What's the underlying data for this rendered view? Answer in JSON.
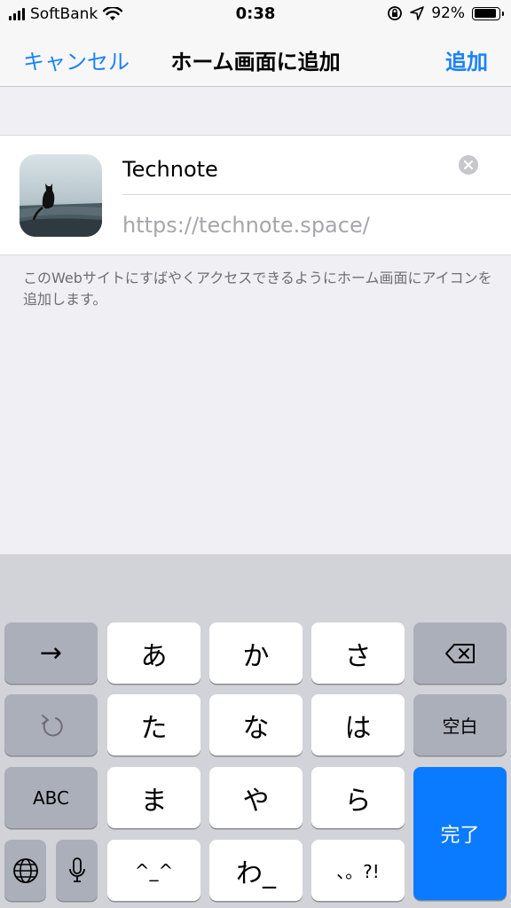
{
  "status": {
    "carrier": "SoftBank",
    "time": "0:38",
    "battery": "92%",
    "battery_level": 0.92
  },
  "nav": {
    "cancel": "キャンセル",
    "title": "ホーム画面に追加",
    "add": "追加"
  },
  "bookmark": {
    "title": "Technote",
    "url": "https://technote.space/"
  },
  "help_text": "このWebサイトにすばやくアクセスできるようにホーム画面にアイコンを追加します。",
  "keyboard": {
    "r1": [
      "→",
      "あ",
      "か",
      "さ"
    ],
    "r2": [
      "た",
      "な",
      "は",
      "空白"
    ],
    "r3": [
      "ABC",
      "ま",
      "や",
      "ら"
    ],
    "r4": [
      "^_^",
      "わ_",
      "、。?!"
    ],
    "done": "完了"
  }
}
